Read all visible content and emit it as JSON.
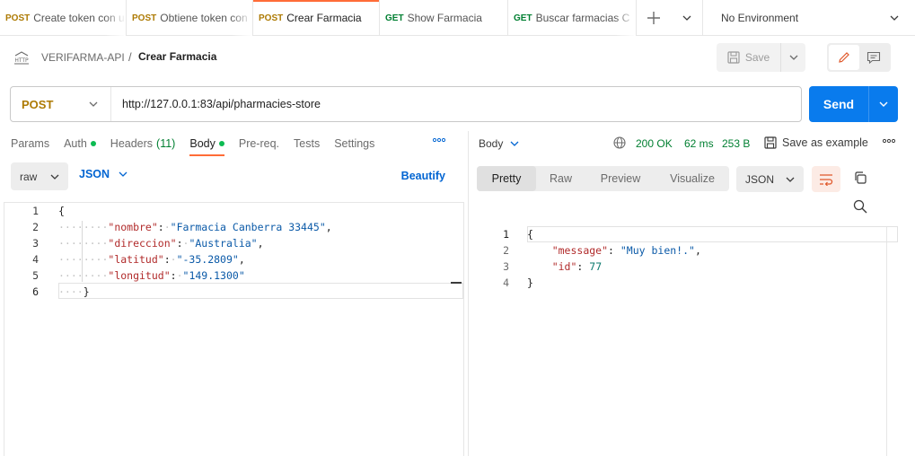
{
  "tabs": [
    {
      "method": "POST",
      "name": "Create token con u"
    },
    {
      "method": "POST",
      "name": "Obtiene token con"
    },
    {
      "method": "POST",
      "name": "Crear Farmacia"
    },
    {
      "method": "GET",
      "name": "Show Farmacia"
    },
    {
      "method": "GET",
      "name": "Buscar farmacias C"
    }
  ],
  "environment": "No Environment",
  "breadcrumb": {
    "collection": "VERIFARMA-API",
    "separator": "/",
    "request": "Crear Farmacia"
  },
  "toolbar": {
    "save_label": "Save"
  },
  "request": {
    "method": "POST",
    "url": "http://127.0.0.1:83/api/pharmacies-store",
    "send_label": "Send"
  },
  "request_tabs": {
    "params": "Params",
    "auth": "Auth",
    "headers": "Headers",
    "headers_count": "(11)",
    "body": "Body",
    "prereq": "Pre-req.",
    "tests": "Tests",
    "settings": "Settings"
  },
  "body_options": {
    "mode": "raw",
    "language": "JSON",
    "beautify": "Beautify"
  },
  "request_body": {
    "line_numbers": [
      "1",
      "2",
      "3",
      "4",
      "5",
      "6"
    ],
    "open": "{",
    "close": "}",
    "fields": [
      {
        "key": "\"nombre\"",
        "value": "\"Farmacia Canberra 33445\""
      },
      {
        "key": "\"direccion\"",
        "value": "\"Australia\""
      },
      {
        "key": "\"latitud\"",
        "value": "\"-35.2809\""
      },
      {
        "key": "\"longitud\"",
        "value": "\"149.1300\""
      }
    ]
  },
  "response": {
    "section_label": "Body",
    "status": "200 OK",
    "time": "62 ms",
    "size": "253 B",
    "save_example": "Save as example",
    "view_tabs": [
      "Pretty",
      "Raw",
      "Preview",
      "Visualize"
    ],
    "format": "JSON",
    "line_numbers": [
      "1",
      "2",
      "3",
      "4"
    ],
    "open": "{",
    "close": "}",
    "fields": [
      {
        "key": "\"message\"",
        "value": "\"Muy bien!.\""
      },
      {
        "key": "\"id\"",
        "value": "77"
      }
    ]
  },
  "colors": {
    "post": "#ad7a03",
    "get": "#007f31",
    "accent": "#ff6c37",
    "send": "#097bed",
    "status_ok": "#007f31",
    "link": "#0265d2"
  }
}
